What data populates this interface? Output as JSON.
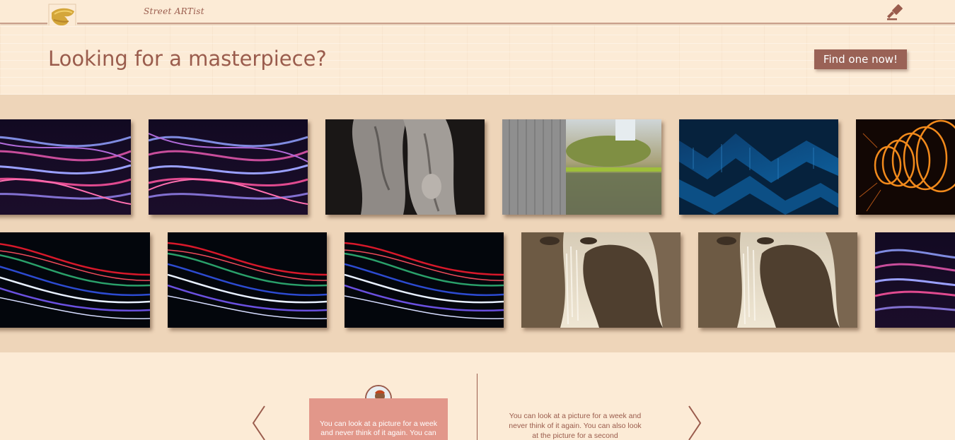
{
  "nav": {
    "brand": "Street ARTist",
    "logo_icon": "paint-swatch-icon",
    "gavel_icon": "gavel-icon"
  },
  "hero": {
    "title": "Looking for a masterpiece?",
    "cta_label": "Find one now!"
  },
  "gallery": {
    "row1": [
      "light-waves-purple",
      "light-waves-purple",
      "marble-statue",
      "reflecting-pool",
      "blue-wave-sculpture",
      "orange-light-spiral"
    ],
    "row2": [
      "light-trails-neon",
      "light-trails-neon",
      "light-trails-neon",
      "waterfall-painting",
      "waterfall-painting",
      "light-waves-purple"
    ]
  },
  "testimonials": {
    "left_arrow_icon": "chevron-left-icon",
    "right_arrow_icon": "chevron-right-icon",
    "card_quote": "You can look at a picture for a week and never think of it again. You can",
    "plain_quote": "You can look at a picture for a week and never think of it again. You can also look at the picture for a second"
  },
  "colors": {
    "background": "#fcebd6",
    "accent": "#9a5c4d",
    "gallery_bg": "#eed5b9",
    "card": "#e2978a"
  }
}
